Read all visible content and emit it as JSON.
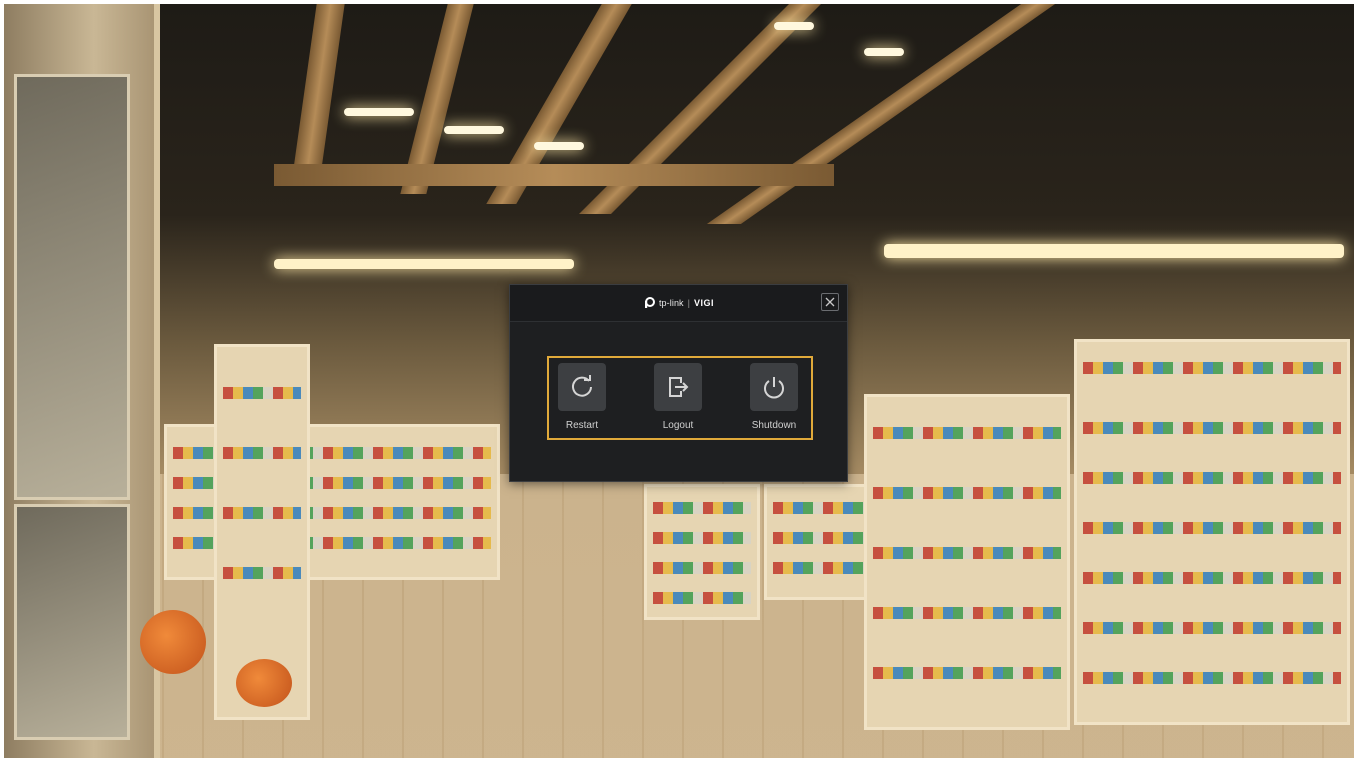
{
  "dialog": {
    "brand_name": "tp-link",
    "brand_separator": "|",
    "brand_product": "VIGI",
    "close_icon": "close-icon",
    "accent_color": "#e1a93a",
    "actions": [
      {
        "label": "Restart",
        "icon": "restart-icon"
      },
      {
        "label": "Logout",
        "icon": "logout-icon"
      },
      {
        "label": "Shutdown",
        "icon": "power-icon"
      }
    ]
  }
}
